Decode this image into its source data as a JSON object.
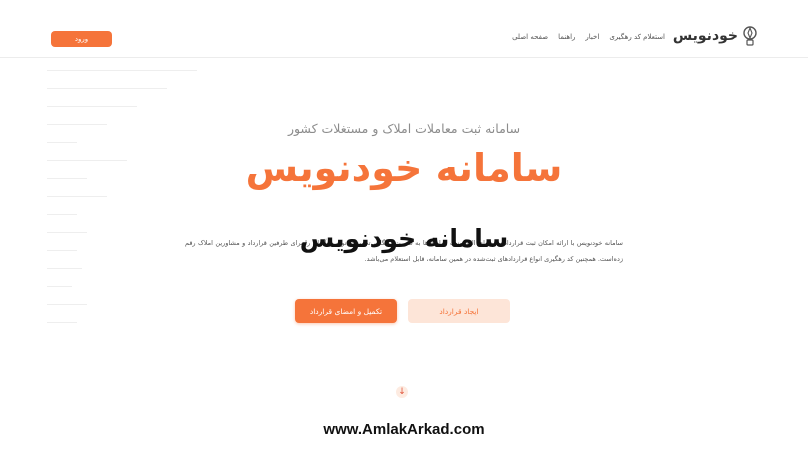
{
  "header": {
    "login_label": "ورود",
    "brand_name": "خودنویس",
    "nav": [
      {
        "label": "صفحه اصلی"
      },
      {
        "label": "راهنما"
      },
      {
        "label": "اخبار"
      },
      {
        "label": "استعلام کد رهگیری"
      }
    ]
  },
  "hero": {
    "subtitle": "سامانه ثبت معاملات املاک و مستغلات کشور",
    "title": "سامانه خودنویس",
    "description": "سامانه خودنویس با ارائه امکان ثبت قرارداد و امضای الکترونیک قراردادها به صورت رایگان، تجربه‌ای نوین و آسان را برای طرفین قرارداد و مشاورین املاک رقم زده‌است. همچنین کد رهگیری انواع قراردادهای ثبت‌شده در همین سامانه، قابل استعلام می‌باشد.",
    "overlay_title": "سامانه خودنویس",
    "primary_button": "تکمیل و امضای قرارداد",
    "secondary_button": "ایجاد قرارداد"
  },
  "footer": {
    "website": "www.AmlakArkad.com"
  },
  "colors": {
    "accent": "#f5743a",
    "accent_light": "#fde5d8"
  },
  "icons": {
    "brand": "pen-logo-icon",
    "scroll": "arrow-down-icon"
  }
}
